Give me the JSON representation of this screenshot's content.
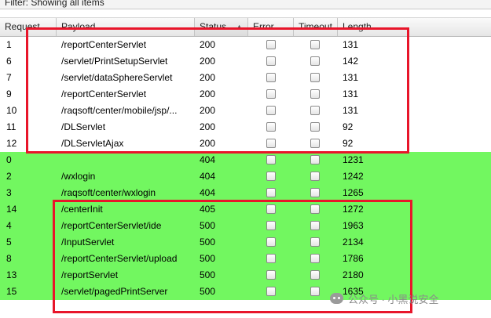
{
  "filter": {
    "text": "Filter: Showing all items"
  },
  "table": {
    "columns": [
      {
        "label": "Request",
        "sorted": false
      },
      {
        "label": "Payload",
        "sorted": false
      },
      {
        "label": "Status",
        "sorted": true,
        "sort_icon": "sort-ascending-icon"
      },
      {
        "label": "Error",
        "sorted": false
      },
      {
        "label": "Timeout",
        "sorted": false
      },
      {
        "label": "Length",
        "sorted": false
      }
    ],
    "highlight_color": "#72f760",
    "rows": [
      {
        "request": "1",
        "payload": "/reportCenterServlet",
        "status": "200",
        "error": false,
        "timeout": false,
        "length": "131",
        "highlighted": false
      },
      {
        "request": "6",
        "payload": "/servlet/PrintSetupServlet",
        "status": "200",
        "error": false,
        "timeout": false,
        "length": "142",
        "highlighted": false
      },
      {
        "request": "7",
        "payload": "/servlet/dataSphereServlet",
        "status": "200",
        "error": false,
        "timeout": false,
        "length": "131",
        "highlighted": false
      },
      {
        "request": "9",
        "payload": "/reportCenterServlet",
        "status": "200",
        "error": false,
        "timeout": false,
        "length": "131",
        "highlighted": false
      },
      {
        "request": "10",
        "payload": "/raqsoft/center/mobile/jsp/...",
        "status": "200",
        "error": false,
        "timeout": false,
        "length": "131",
        "highlighted": false
      },
      {
        "request": "11",
        "payload": "/DLServlet",
        "status": "200",
        "error": false,
        "timeout": false,
        "length": "92",
        "highlighted": false
      },
      {
        "request": "12",
        "payload": "/DLServletAjax",
        "status": "200",
        "error": false,
        "timeout": false,
        "length": "92",
        "highlighted": false
      },
      {
        "request": "0",
        "payload": "",
        "status": "404",
        "error": false,
        "timeout": false,
        "length": "1231",
        "highlighted": true
      },
      {
        "request": "2",
        "payload": "/wxlogin",
        "status": "404",
        "error": false,
        "timeout": false,
        "length": "1242",
        "highlighted": true
      },
      {
        "request": "3",
        "payload": "/raqsoft/center/wxlogin",
        "status": "404",
        "error": false,
        "timeout": false,
        "length": "1265",
        "highlighted": true
      },
      {
        "request": "14",
        "payload": "/centerInit",
        "status": "405",
        "error": false,
        "timeout": false,
        "length": "1272",
        "highlighted": true
      },
      {
        "request": "4",
        "payload": "/reportCenterServlet/ide",
        "status": "500",
        "error": false,
        "timeout": false,
        "length": "1963",
        "highlighted": true
      },
      {
        "request": "5",
        "payload": "/InputServlet",
        "status": "500",
        "error": false,
        "timeout": false,
        "length": "2134",
        "highlighted": true
      },
      {
        "request": "8",
        "payload": "/reportCenterServlet/upload",
        "status": "500",
        "error": false,
        "timeout": false,
        "length": "1786",
        "highlighted": true
      },
      {
        "request": "13",
        "payload": "/reportServlet",
        "status": "500",
        "error": false,
        "timeout": false,
        "length": "2180",
        "highlighted": true
      },
      {
        "request": "15",
        "payload": "/servlet/pagedPrintServer",
        "status": "500",
        "error": false,
        "timeout": false,
        "length": "1635",
        "highlighted": true
      }
    ]
  },
  "annotation_color": "#e8152a",
  "watermark": {
    "text": "公众号 · 小黑说安全",
    "logo_icon": "wechat-icon"
  }
}
